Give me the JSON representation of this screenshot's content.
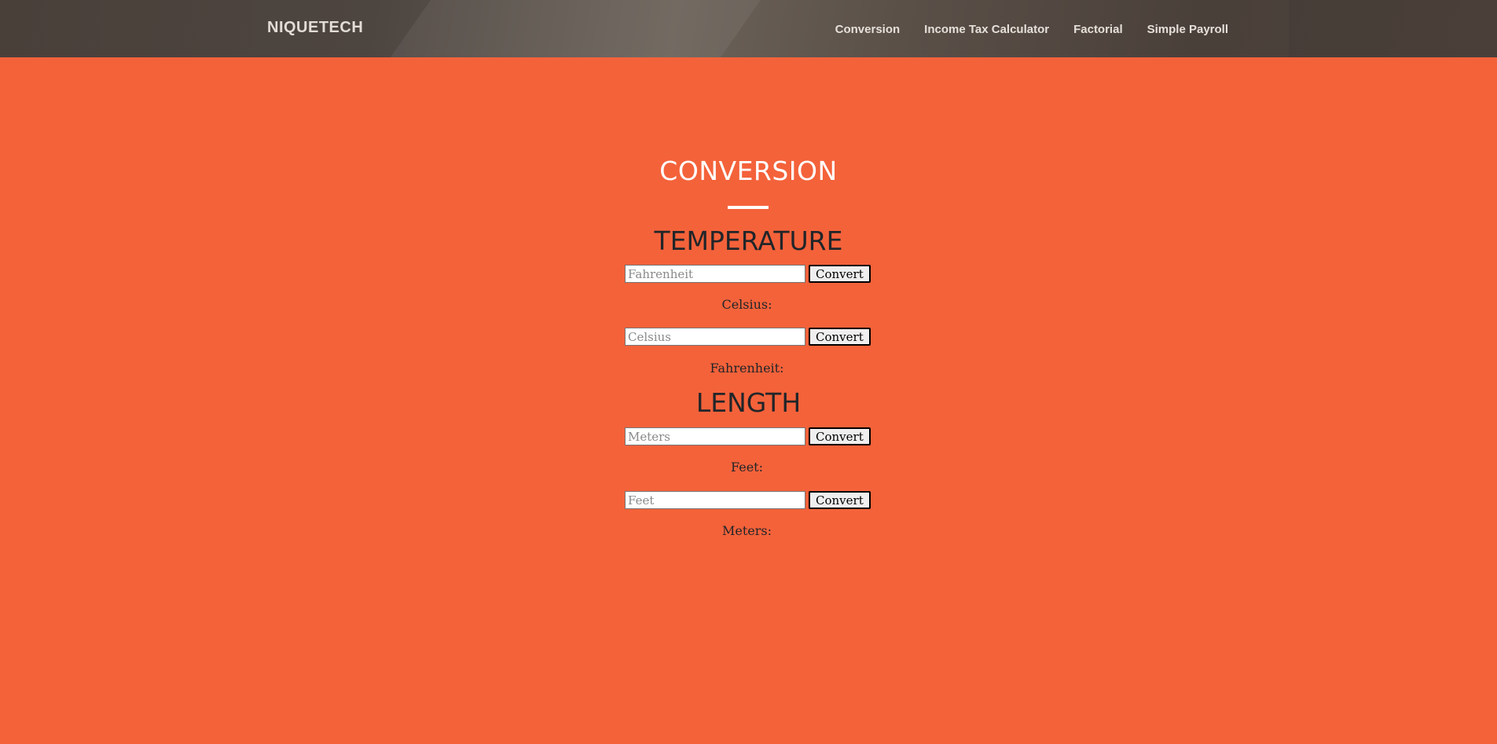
{
  "navbar": {
    "brand": "NIQUETECH",
    "links": [
      {
        "label": "Conversion"
      },
      {
        "label": "Income Tax Calculator"
      },
      {
        "label": "Factorial"
      },
      {
        "label": "Simple Payroll"
      }
    ]
  },
  "page": {
    "title": "CONVERSION"
  },
  "temperature": {
    "title": "TEMPERATURE",
    "fahrenheit_input": {
      "placeholder": "Fahrenheit",
      "value": ""
    },
    "fahrenheit_button": "Convert",
    "celsius_result_label": "Celsius:",
    "celsius_result_value": "",
    "celsius_input": {
      "placeholder": "Celsius",
      "value": ""
    },
    "celsius_button": "Convert",
    "fahrenheit_result_label": "Fahrenheit:",
    "fahrenheit_result_value": ""
  },
  "length": {
    "title": "LENGTH",
    "meters_input": {
      "placeholder": "Meters",
      "value": ""
    },
    "meters_button": "Convert",
    "feet_result_label": "Feet:",
    "feet_result_value": "",
    "feet_input": {
      "placeholder": "Feet",
      "value": ""
    },
    "feet_button": "Convert",
    "meters_result_label": "Meters:",
    "meters_result_value": ""
  },
  "colors": {
    "background": "#f4623a",
    "navbar": "#4a403a",
    "heading_dark": "#212529",
    "heading_light": "#ffffff"
  }
}
